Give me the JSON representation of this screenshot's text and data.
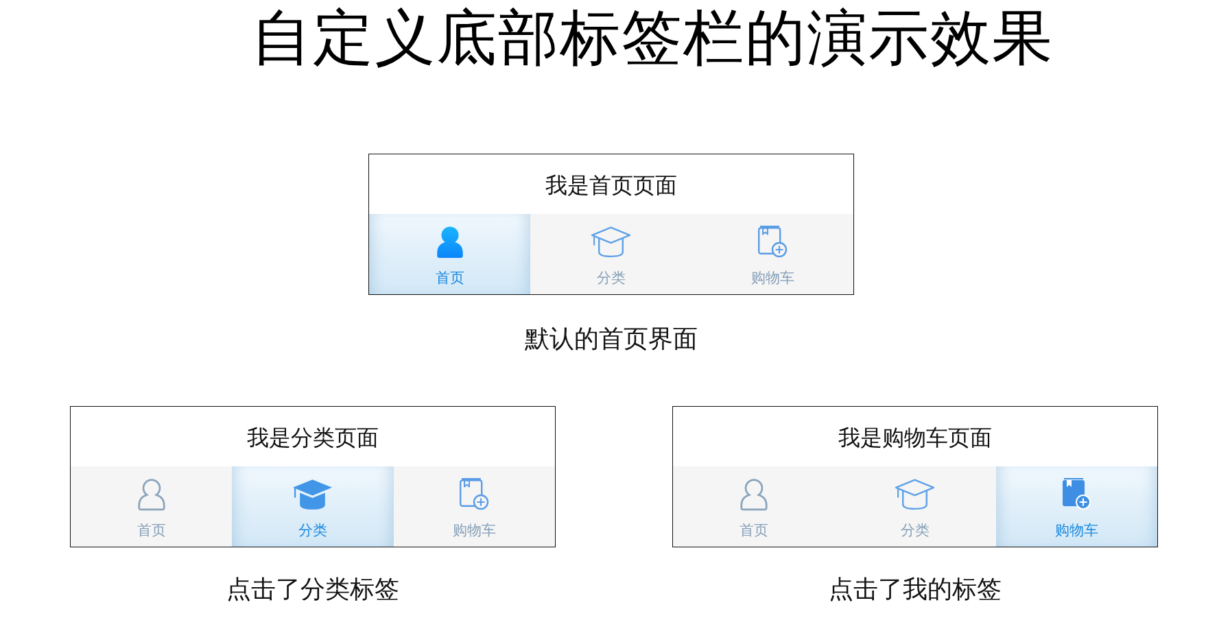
{
  "title": "自定义底部标签栏的演示效果",
  "demos": [
    {
      "page_text": "我是首页页面",
      "tabs": [
        {
          "label": "首页",
          "selected": true
        },
        {
          "label": "分类",
          "selected": false
        },
        {
          "label": "购物车",
          "selected": false
        }
      ],
      "caption": "默认的首页界面"
    },
    {
      "page_text": "我是分类页面",
      "tabs": [
        {
          "label": "首页",
          "selected": false
        },
        {
          "label": "分类",
          "selected": true
        },
        {
          "label": "购物车",
          "selected": false
        }
      ],
      "caption": "点击了分类标签"
    },
    {
      "page_text": "我是购物车页面",
      "tabs": [
        {
          "label": "首页",
          "selected": false
        },
        {
          "label": "分类",
          "selected": false
        },
        {
          "label": "购物车",
          "selected": true
        }
      ],
      "caption": "点击了我的标签"
    }
  ]
}
